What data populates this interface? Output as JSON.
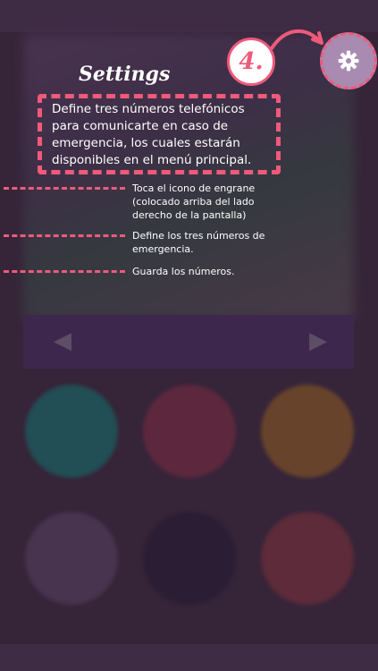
{
  "step": {
    "number": "4."
  },
  "title": "Settings",
  "description": "Define tres números telefónicos para comunicarte en caso de emergencia, los cuales estarán disponibles en el menú principal.",
  "steps": [
    {
      "text": "Toca el icono de engrane (colocado arriba del lado derecho de la pantalla)"
    },
    {
      "text": "Define los tres números de emergencia."
    },
    {
      "text": "Guarda los números."
    }
  ],
  "icons": {
    "settings": "gear-icon",
    "nav_left": "chevron-left-icon",
    "nav_right": "chevron-right-icon"
  },
  "colors": {
    "accent": "#ef5a7a",
    "background": "#3e2a3f",
    "gear_circle": "#a98ab0"
  }
}
